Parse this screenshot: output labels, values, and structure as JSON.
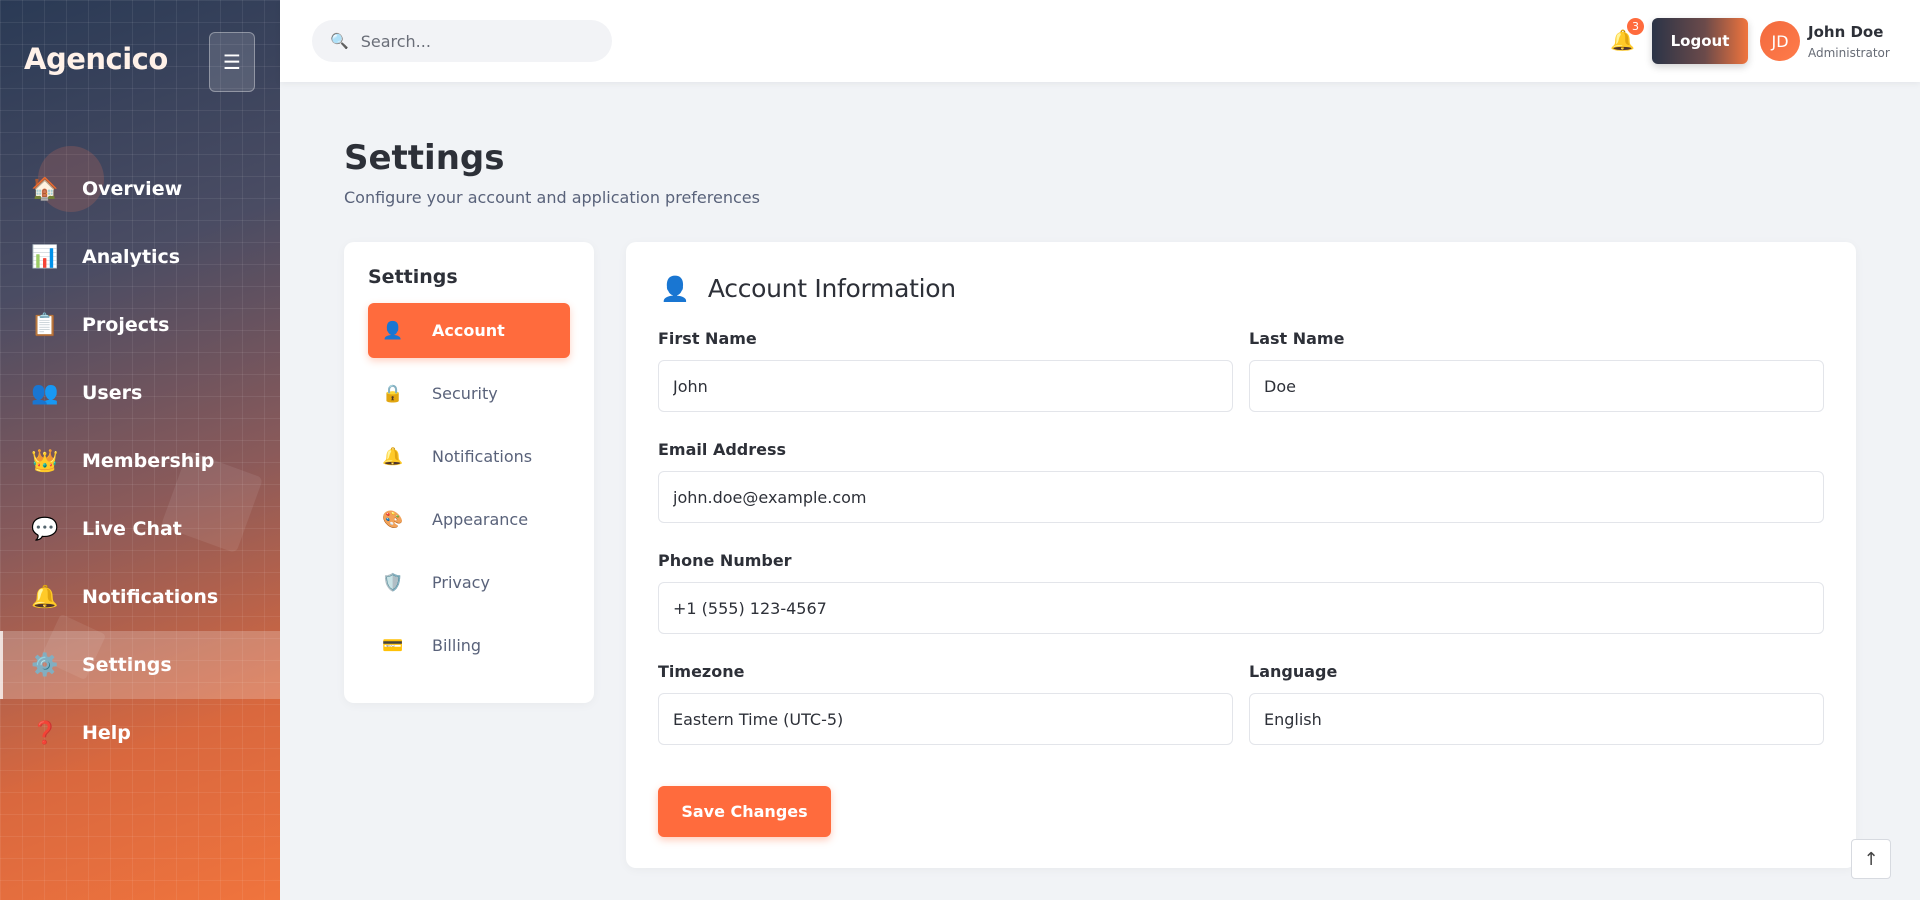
{
  "app": {
    "brand": "Agencico"
  },
  "sidebar": {
    "items": [
      {
        "label": "Overview",
        "icon": "house-icon",
        "glyph": "🏠"
      },
      {
        "label": "Analytics",
        "icon": "bar-chart-icon",
        "glyph": "📊"
      },
      {
        "label": "Projects",
        "icon": "clipboard-icon",
        "glyph": "📋"
      },
      {
        "label": "Users",
        "icon": "users-icon",
        "glyph": "👥"
      },
      {
        "label": "Membership",
        "icon": "crown-icon",
        "glyph": "👑"
      },
      {
        "label": "Live Chat",
        "icon": "chat-bubble-icon",
        "glyph": "💬"
      },
      {
        "label": "Notifications",
        "icon": "bell-icon",
        "glyph": "🔔"
      },
      {
        "label": "Settings",
        "icon": "gear-icon",
        "glyph": "⚙️",
        "active": true
      },
      {
        "label": "Help",
        "icon": "question-icon",
        "glyph": "❓"
      }
    ]
  },
  "topbar": {
    "search_placeholder": "Search...",
    "notification_count": "3",
    "logout_label": "Logout",
    "user": {
      "initials": "JD",
      "name": "John Doe",
      "role": "Administrator"
    }
  },
  "page": {
    "title": "Settings",
    "subtitle": "Configure your account and application preferences"
  },
  "settings_nav": {
    "heading": "Settings",
    "items": [
      {
        "label": "Account",
        "icon": "user-icon",
        "glyph": "👤",
        "active": true
      },
      {
        "label": "Security",
        "icon": "lock-icon",
        "glyph": "🔒"
      },
      {
        "label": "Notifications",
        "icon": "bell-icon",
        "glyph": "🔔"
      },
      {
        "label": "Appearance",
        "icon": "palette-icon",
        "glyph": "🎨"
      },
      {
        "label": "Privacy",
        "icon": "shield-icon",
        "glyph": "🛡️"
      },
      {
        "label": "Billing",
        "icon": "credit-card-icon",
        "glyph": "💳"
      }
    ]
  },
  "account_form": {
    "title": "Account Information",
    "first_name": {
      "label": "First Name",
      "value": "John"
    },
    "last_name": {
      "label": "Last Name",
      "value": "Doe"
    },
    "email": {
      "label": "Email Address",
      "value": "john.doe@example.com"
    },
    "phone": {
      "label": "Phone Number",
      "value": "+1 (555) 123-4567"
    },
    "timezone": {
      "label": "Timezone",
      "value": "Eastern Time (UTC-5)"
    },
    "language": {
      "label": "Language",
      "value": "English"
    },
    "save_label": "Save Changes"
  },
  "colors": {
    "accent": "#ff6b3d",
    "text": "#2d3038",
    "muted": "#59627a"
  }
}
